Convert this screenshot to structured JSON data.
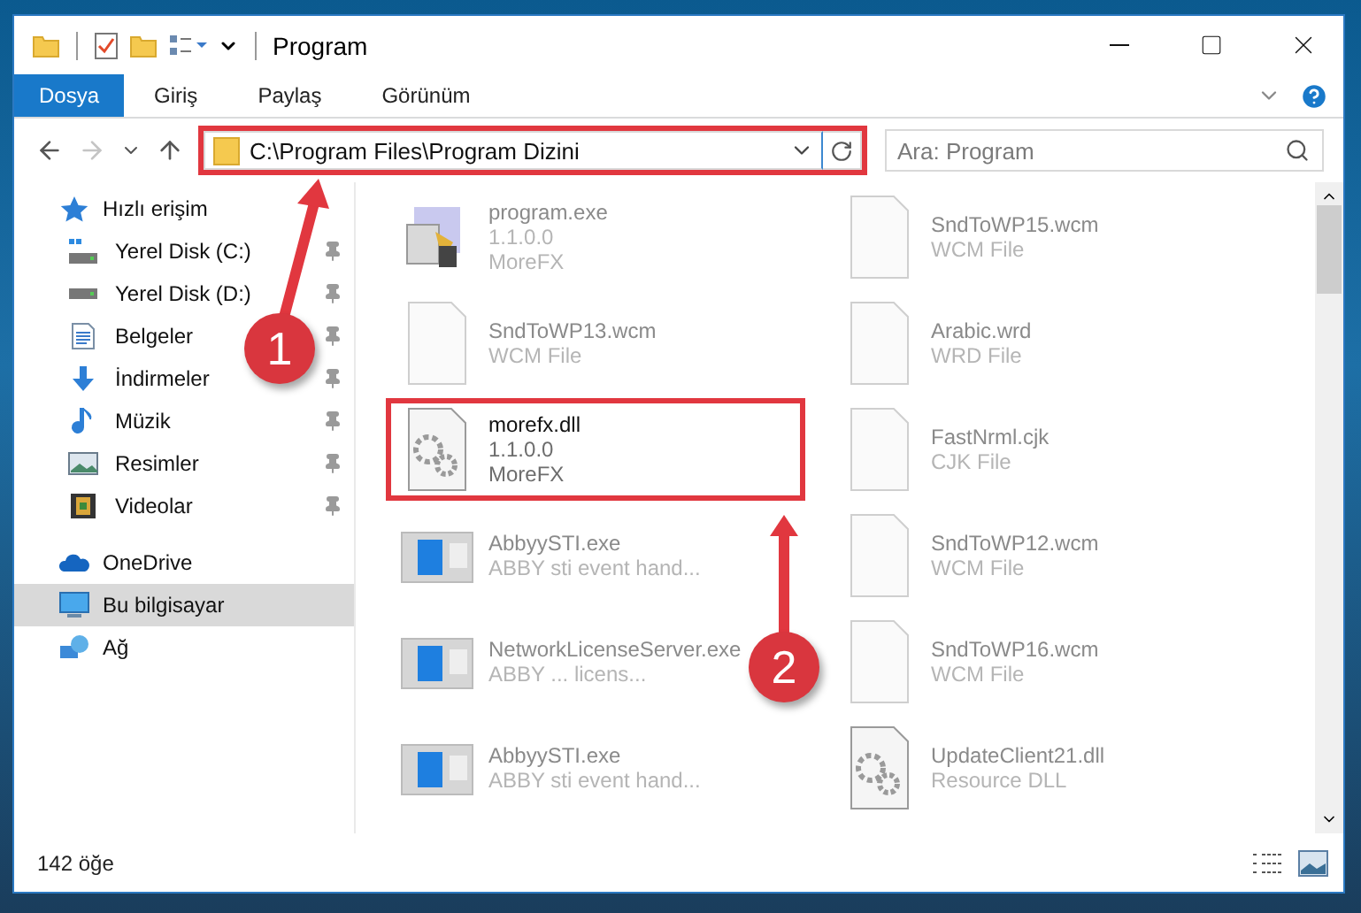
{
  "window": {
    "title": "Program"
  },
  "ribbon_tabs": [
    {
      "label": "Dosya",
      "selected": true
    },
    {
      "label": "Giriş",
      "selected": false
    },
    {
      "label": "Paylaş",
      "selected": false
    },
    {
      "label": "Görünüm",
      "selected": false
    }
  ],
  "address_bar": {
    "path": "C:\\Program Files\\Program Dizini",
    "highlighted": true
  },
  "search": {
    "placeholder": "Ara: Program"
  },
  "sidebar": {
    "items": [
      {
        "label": "Hızlı erişim",
        "kind": "star",
        "selected": false,
        "children": [
          {
            "label": "Yerel Disk (C:)",
            "kind": "system-drive",
            "pinned": true,
            "selected": false
          },
          {
            "label": "Yerel Disk (D:)",
            "kind": "drive",
            "pinned": true,
            "selected": false
          },
          {
            "label": "Belgeler",
            "kind": "documents",
            "pinned": true,
            "selected": false
          },
          {
            "label": "İndirmeler",
            "kind": "download",
            "pinned": true,
            "selected": false
          },
          {
            "label": "Müzik",
            "kind": "music",
            "pinned": true,
            "selected": false
          },
          {
            "label": "Resimler",
            "kind": "pictures",
            "pinned": true,
            "selected": false
          },
          {
            "label": "Videolar",
            "kind": "videos",
            "pinned": true,
            "selected": false
          }
        ]
      },
      {
        "label": "OneDrive",
        "kind": "cloud",
        "selected": false
      },
      {
        "label": "Bu bilgisayar",
        "kind": "computer",
        "selected": true
      },
      {
        "label": "Ağ",
        "kind": "network",
        "selected": false
      }
    ]
  },
  "files": [
    {
      "name": "program.exe",
      "details": [
        "1.1.0.0",
        "MoreFX"
      ],
      "kind": "installer",
      "highlighted": false
    },
    {
      "name": "SndToWP15.wcm",
      "details": [
        "WCM File"
      ],
      "kind": "document",
      "highlighted": false
    },
    {
      "name": "SndToWP13.wcm",
      "details": [
        "WCM File"
      ],
      "kind": "document",
      "highlighted": false
    },
    {
      "name": "Arabic.wrd",
      "details": [
        "WRD File"
      ],
      "kind": "document",
      "highlighted": false
    },
    {
      "name": "morefx.dll",
      "details": [
        "1.1.0.0",
        "MoreFX"
      ],
      "kind": "library",
      "highlighted": true
    },
    {
      "name": "FastNrml.cjk",
      "details": [
        "CJK File"
      ],
      "kind": "document",
      "highlighted": false
    },
    {
      "name": "AbbyySTI.exe",
      "details": [
        "ABBY sti event hand..."
      ],
      "kind": "application",
      "highlighted": false
    },
    {
      "name": "SndToWP12.wcm",
      "details": [
        "WCM File"
      ],
      "kind": "document",
      "highlighted": false
    },
    {
      "name": "NetworkLicenseServer.exe",
      "details": [
        "ABBY ... licens..."
      ],
      "kind": "application",
      "highlighted": false
    },
    {
      "name": "SndToWP16.wcm",
      "details": [
        "WCM File"
      ],
      "kind": "document",
      "highlighted": false
    },
    {
      "name": "AbbyySTI.exe",
      "details": [
        "ABBY sti event hand..."
      ],
      "kind": "application",
      "highlighted": false
    },
    {
      "name": "UpdateClient21.dll",
      "details": [
        "Resource DLL"
      ],
      "kind": "library",
      "highlighted": false
    }
  ],
  "status_bar": {
    "item_count": "142 öğe"
  },
  "callouts": [
    {
      "number": "1"
    },
    {
      "number": "2"
    }
  ]
}
